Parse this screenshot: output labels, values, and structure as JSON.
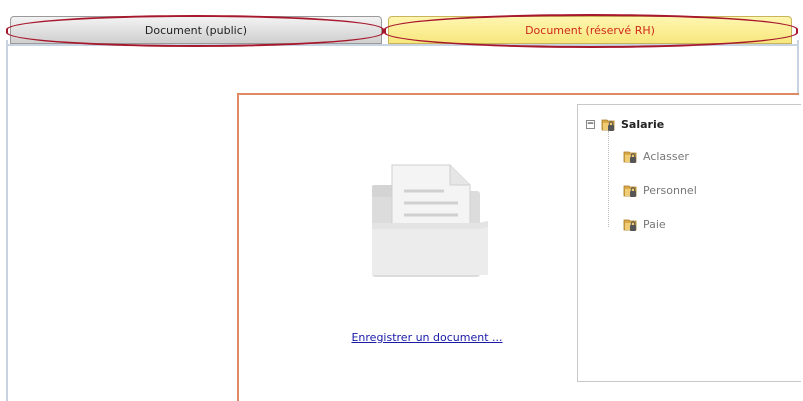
{
  "tabs": {
    "public_label": "Document (public)",
    "rh_label": "Document (réservé RH)"
  },
  "main": {
    "save_link": "Enregistrer un document ..."
  },
  "tree": {
    "root": {
      "label": "Salarie",
      "icon": "folder-lock-icon",
      "expander": "−"
    },
    "children": [
      {
        "label": "Aclasser",
        "icon": "folder-lock-icon"
      },
      {
        "label": "Personnel",
        "icon": "folder-lock-icon"
      },
      {
        "label": "Paie",
        "icon": "folder-lock-icon"
      }
    ]
  },
  "colors": {
    "active_tab_bg": "#f7e77d",
    "active_tab_text": "#d0291a",
    "highlight": "#a7182d",
    "panel_border": "#e08a64",
    "link": "#1a1aa8"
  }
}
